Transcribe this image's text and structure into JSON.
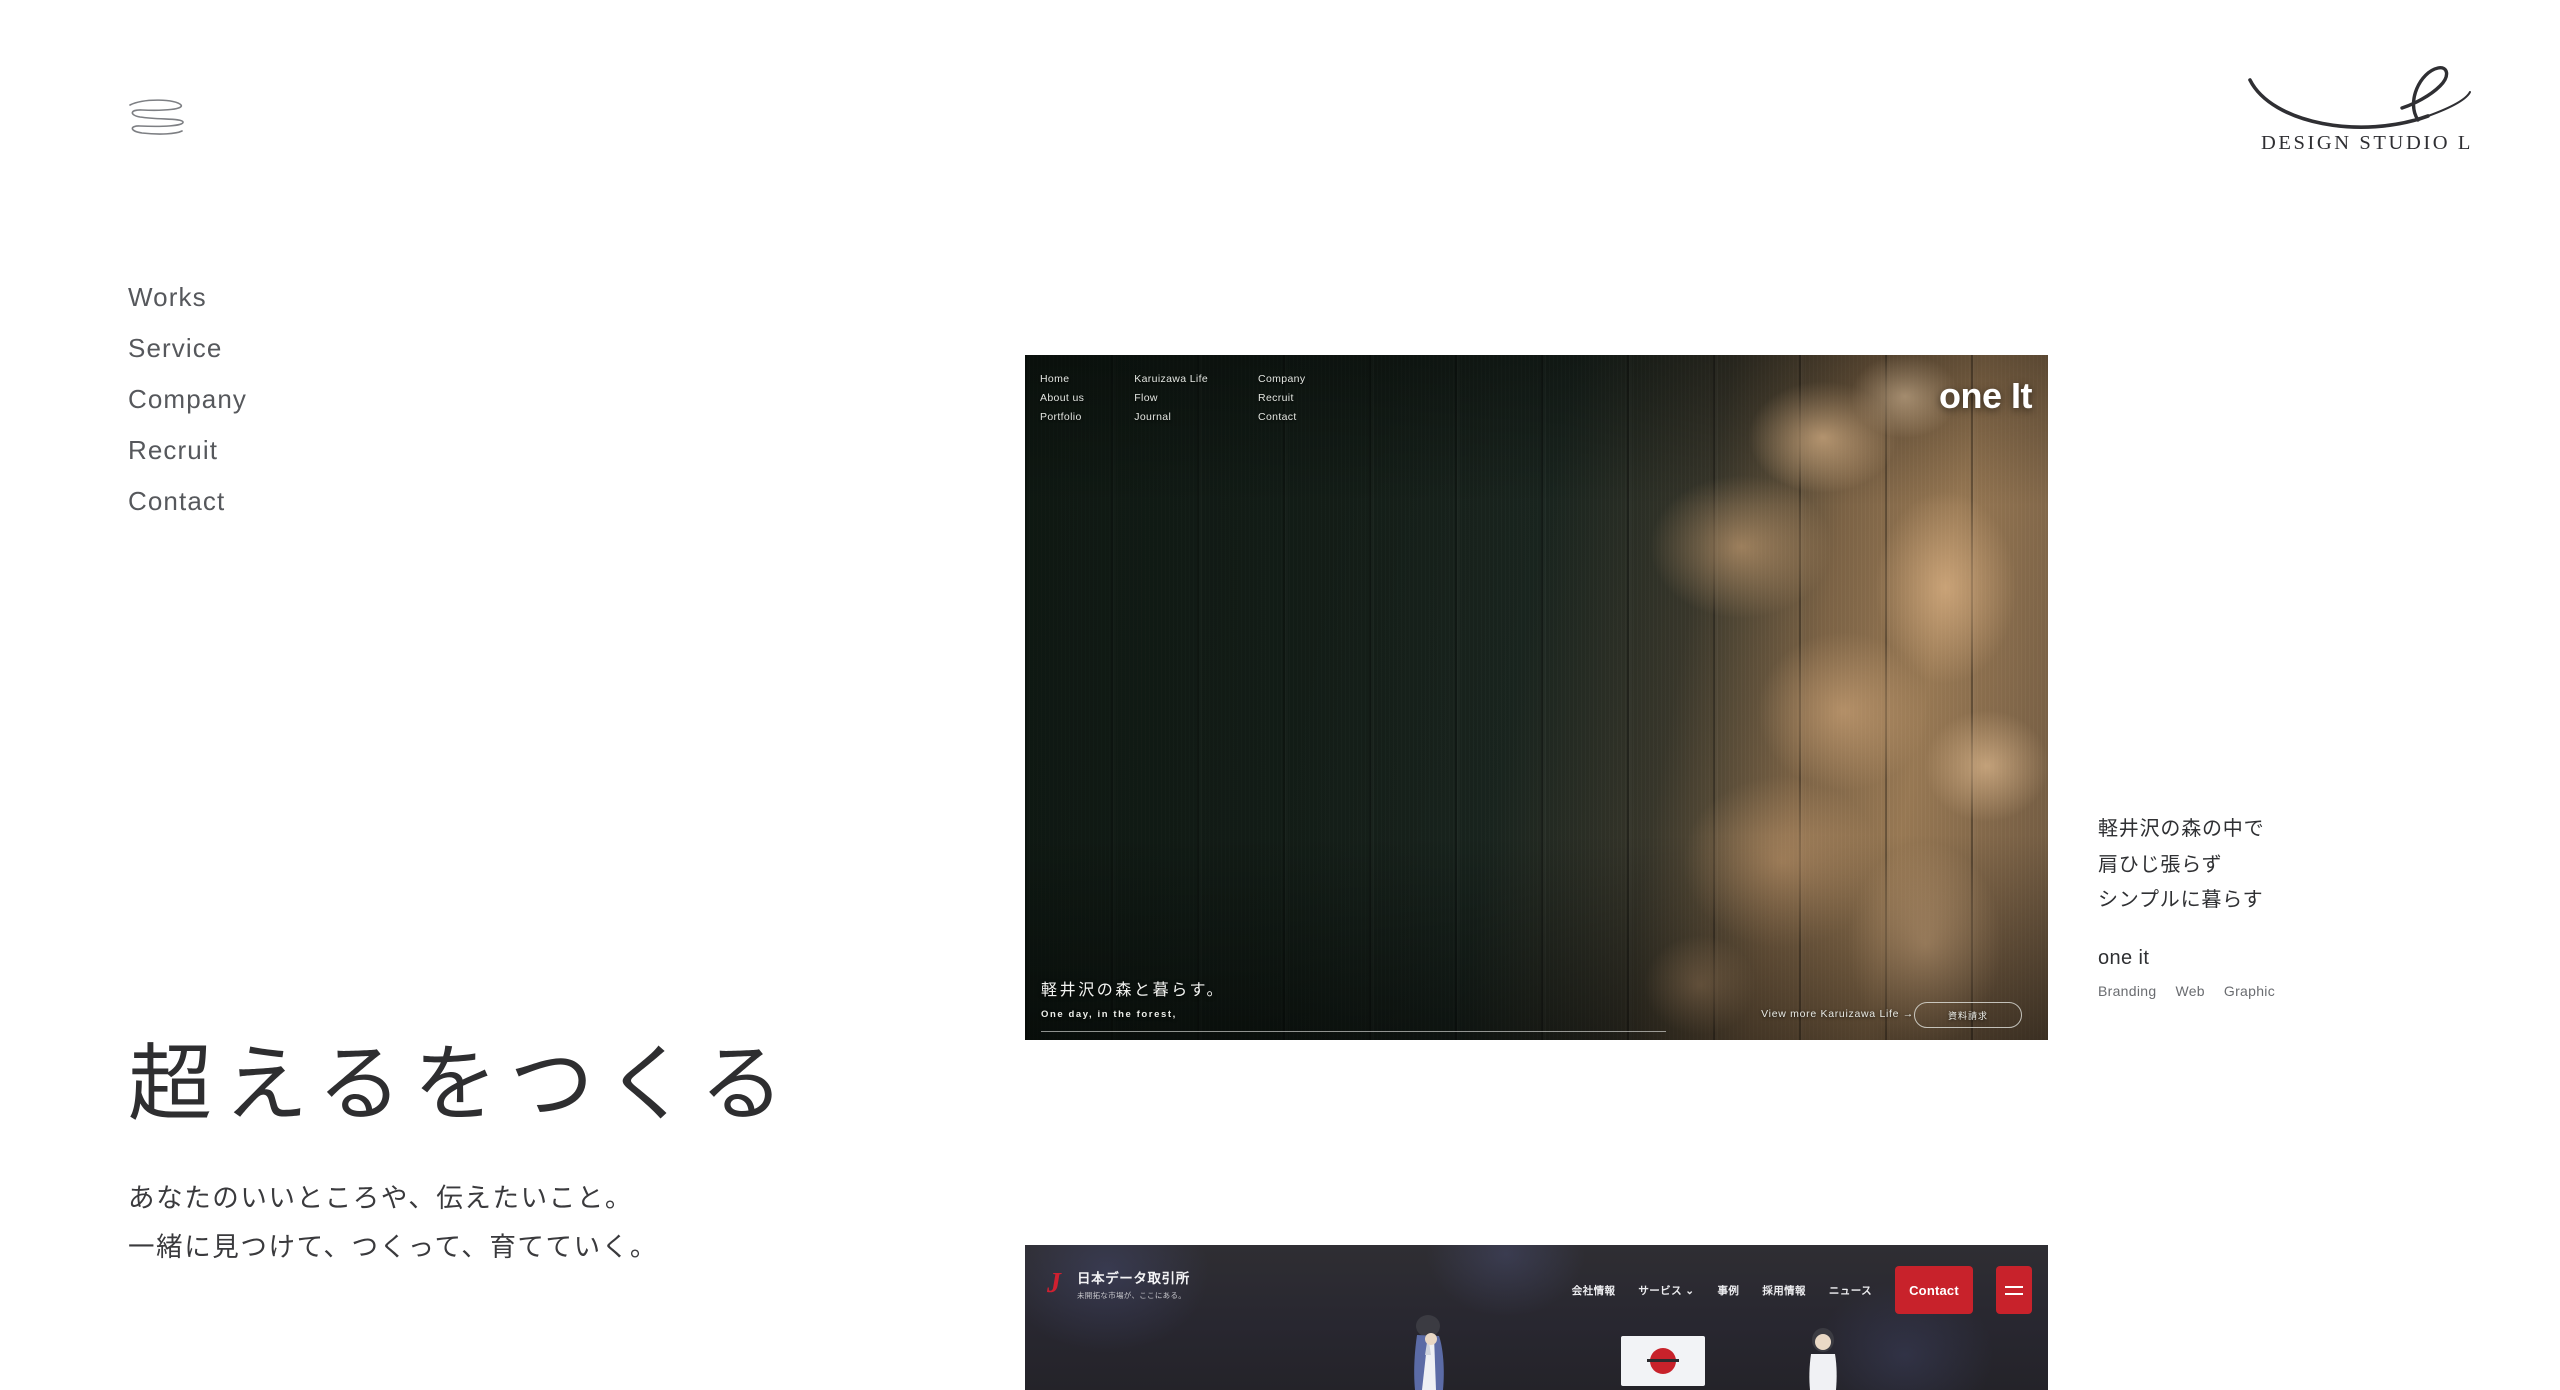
{
  "header": {
    "menu_icon": "squiggle-menu-icon",
    "brand_name": "DESIGN STUDIO L",
    "brand_mark": "cursive-l-swoosh-logo"
  },
  "sitenav": {
    "items": [
      {
        "label": "Works"
      },
      {
        "label": "Service"
      },
      {
        "label": "Company"
      },
      {
        "label": "Recruit"
      },
      {
        "label": "Contact"
      }
    ]
  },
  "hero": {
    "title": "超えるをつくる",
    "sub_line1": "あなたのいいところや、伝えたいこと。",
    "sub_line2": "一緒に見つけて、つくって、育てていく。"
  },
  "work_one": {
    "mini_nav": [
      [
        "Home",
        "About us",
        "Portfolio"
      ],
      [
        "Karuizawa Life",
        "Flow",
        "Journal"
      ],
      [
        "Company",
        "Recruit",
        "Contact"
      ]
    ],
    "wordmark": "one It",
    "headline_jp": "軽井沢の森と暮らす。",
    "headline_en": "One day, in the forest,",
    "view_more": "View more Karuizawa Life  →",
    "pill_label": "資料請求"
  },
  "work_caption": {
    "line1": "軽井沢の森の中で",
    "line2": "肩ひじ張らず",
    "line3": "シンプルに暮らす",
    "project": "one it",
    "tags": [
      "Branding",
      "Web",
      "Graphic"
    ]
  },
  "work_two": {
    "logo_letter": "J",
    "company": "日本データ取引所",
    "tagline": "未開拓な市場が、ここにある。",
    "nav": [
      "会社情報",
      "サービス ⌄",
      "事例",
      "採用情報",
      "ニュース"
    ],
    "contact_label": "Contact",
    "menu_icon": "hamburger-icon"
  },
  "colors": {
    "accent_red": "#c8222b",
    "text_dark": "#2f3033",
    "text_muted": "#6a6c70",
    "forest_dark": "#16201a",
    "charcoal": "#2b2a2e"
  }
}
